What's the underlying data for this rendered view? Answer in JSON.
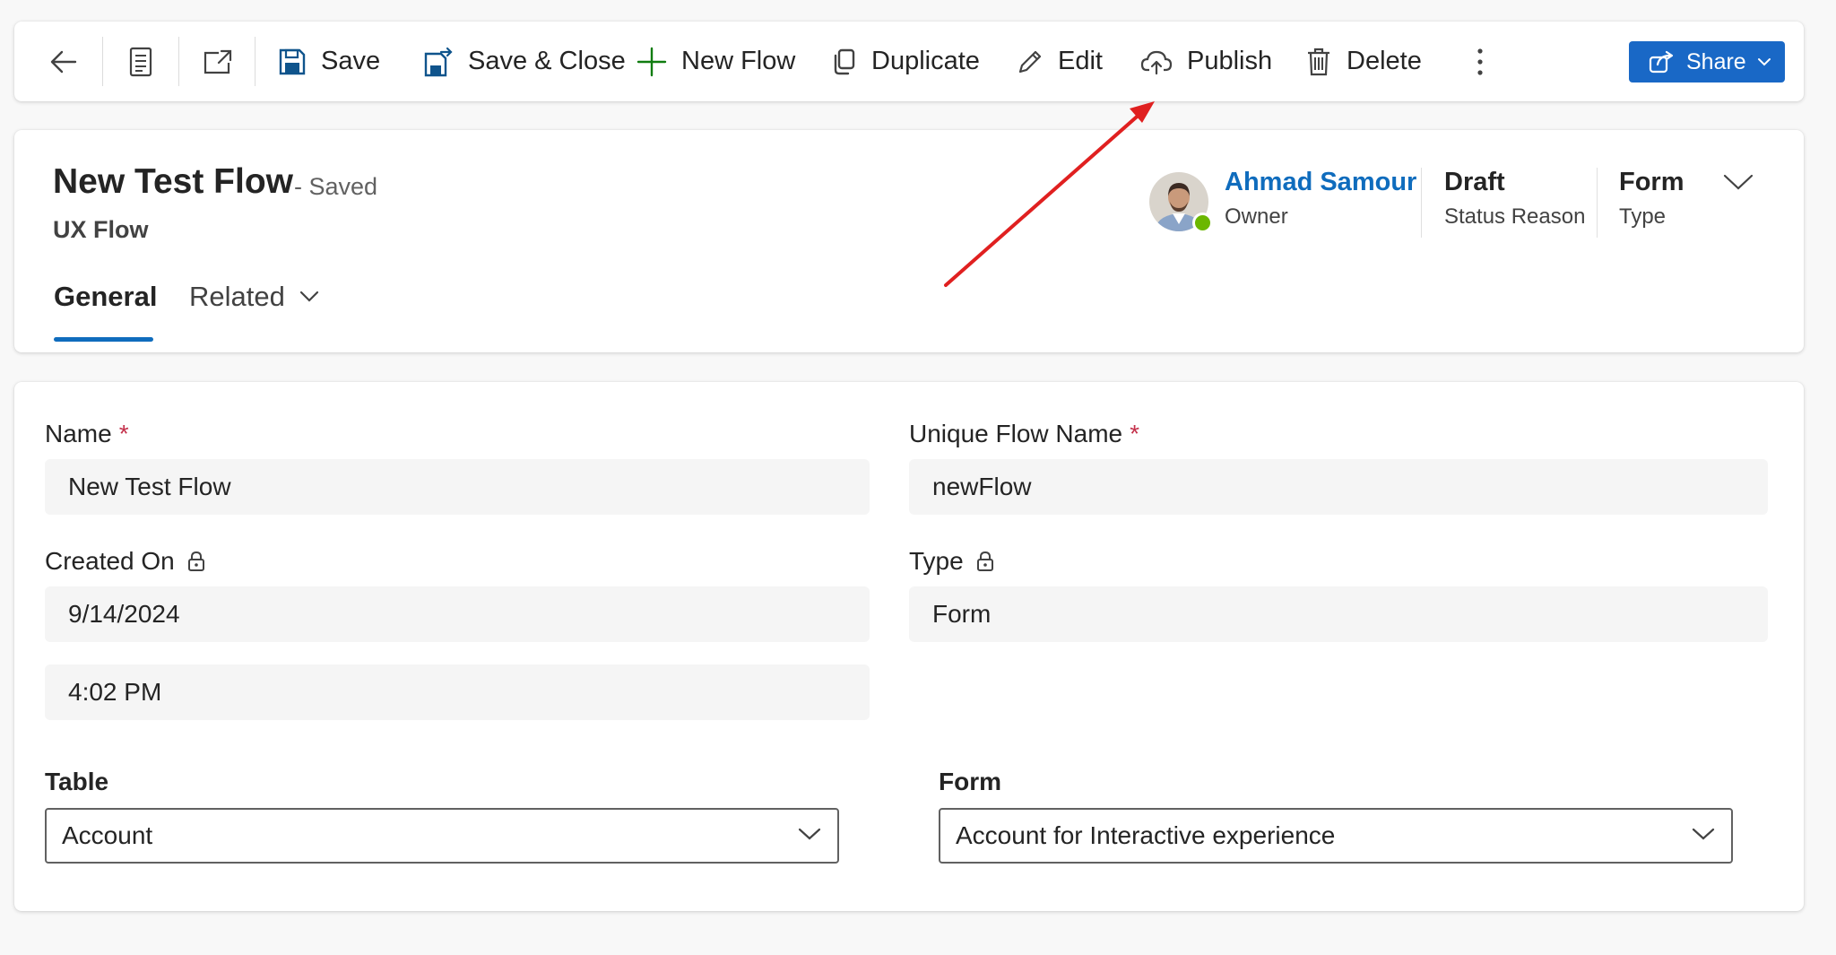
{
  "toolbar": {
    "save": "Save",
    "save_close": "Save & Close",
    "new_flow": "New Flow",
    "duplicate": "Duplicate",
    "edit": "Edit",
    "publish": "Publish",
    "delete": "Delete",
    "share": "Share",
    "icons": [
      "back-arrow-icon",
      "record-set-icon",
      "open-new-window-icon",
      "save-icon",
      "save-close-icon",
      "plus-icon",
      "duplicate-icon",
      "pencil-icon",
      "cloud-upload-icon",
      "trash-icon",
      "more-vertical-icon",
      "share-icon",
      "chevron-down-icon"
    ]
  },
  "header": {
    "title": "New Test Flow",
    "saved_status": "- Saved",
    "entity": "UX Flow",
    "owner_name": "Ahmad Samour",
    "owner_label": "Owner",
    "status_value": "Draft",
    "status_label": "Status Reason",
    "type_value": "Form",
    "type_label": "Type",
    "presence_color": "#6bb700"
  },
  "tabs": [
    {
      "label": "General",
      "selected": true
    },
    {
      "label": "Related",
      "selected": false
    }
  ],
  "form": {
    "name_label": "Name",
    "name_value": "New Test Flow",
    "unique_label": "Unique Flow Name",
    "unique_value": "newFlow",
    "required_marker": "*",
    "created_label": "Created On",
    "created_date": "9/14/2024",
    "created_time": "4:02 PM",
    "type_label": "Type",
    "type_value": "Form",
    "table_label": "Table",
    "table_value": "Account",
    "form_label": "Form",
    "form_value": "Account for Interactive experience"
  },
  "colors": {
    "accent": "#0f6cbd",
    "share_button": "#1968c6",
    "annotation_arrow": "#e02020",
    "required": "#c4314b"
  }
}
